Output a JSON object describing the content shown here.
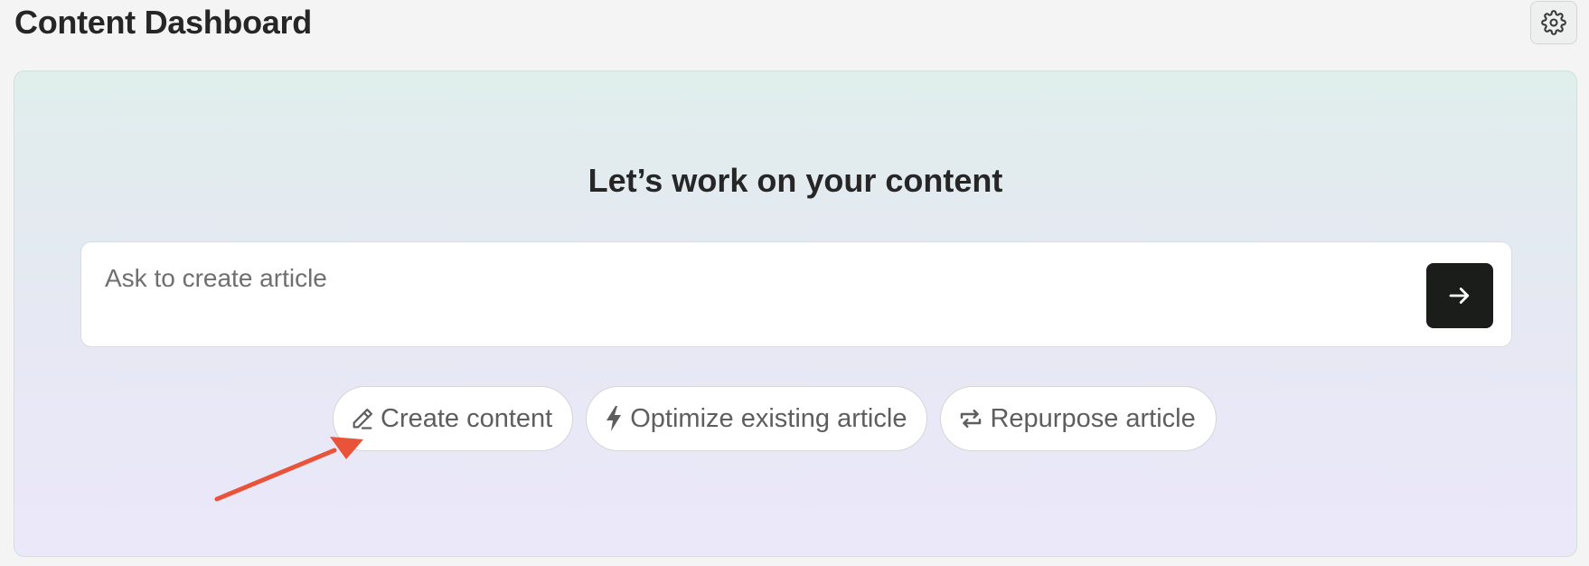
{
  "header": {
    "title": "Content Dashboard",
    "settings_icon": "gear-icon"
  },
  "hero": {
    "heading": "Let’s work on your content",
    "prompt": {
      "placeholder": "Ask to create article",
      "value": "",
      "submit_icon": "arrow-right-icon"
    },
    "actions": [
      {
        "label": "Create content",
        "icon": "pencil-icon"
      },
      {
        "label": "Optimize existing article",
        "icon": "lightning-bolt-icon"
      },
      {
        "label": "Repurpose article",
        "icon": "repeat-icon"
      }
    ]
  },
  "annotation": {
    "arrow_color": "#e8533a",
    "points_to": "Create content"
  },
  "colors": {
    "submit_button_bg": "#1b1d1b",
    "annotation_arrow": "#e8533a"
  }
}
